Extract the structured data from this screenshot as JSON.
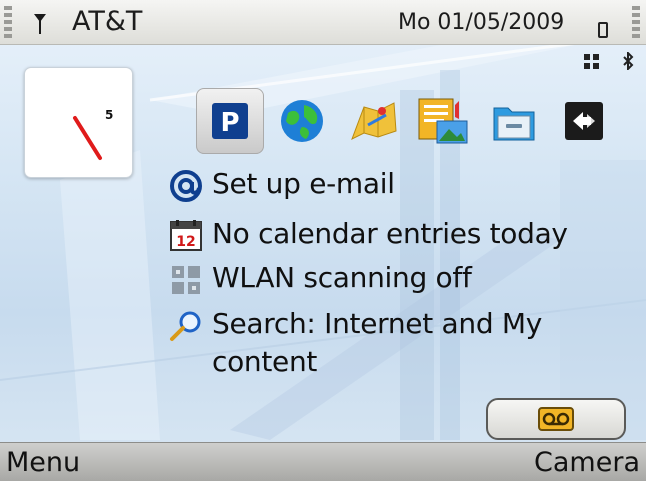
{
  "status_bar": {
    "operator": "AT&T",
    "datetime": "Mo 01/05/2009"
  },
  "clock": {
    "label": "5"
  },
  "shortcuts": [
    {
      "name": "parking-app",
      "icon": "p-icon",
      "selected": true
    },
    {
      "name": "web-browser",
      "icon": "globe-icon"
    },
    {
      "name": "maps",
      "icon": "map-icon"
    },
    {
      "name": "media-gallery",
      "icon": "gallery-icon"
    },
    {
      "name": "file-manager",
      "icon": "folder-icon"
    },
    {
      "name": "sync",
      "icon": "sync-icon"
    }
  ],
  "info_items": [
    {
      "icon": "email-at-icon",
      "text": "Set up e-mail"
    },
    {
      "icon": "calendar-icon",
      "icon_text": "12",
      "text": "No calendar entries today"
    },
    {
      "icon": "wlan-icon",
      "text": "WLAN scanning off"
    },
    {
      "icon": "search-icon",
      "text": "Search: Internet and My",
      "text2": "content"
    }
  ],
  "softkeys": {
    "left": "Menu",
    "right": "Camera"
  },
  "colors": {
    "accent_blue": "#0f3f8f",
    "clock_hand": "#e01b1b"
  }
}
